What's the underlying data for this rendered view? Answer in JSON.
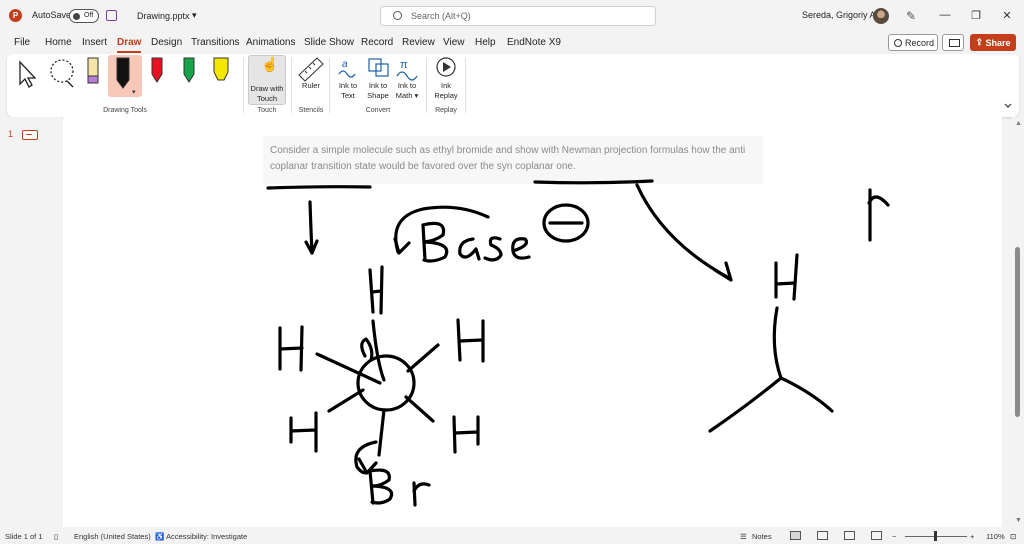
{
  "titlebar": {
    "autosave_label": "AutoSave",
    "autosave_state": "Off",
    "filename": "Drawing.pptx",
    "search_placeholder": "Search (Alt+Q)",
    "user_name": "Sereda, Grigoriy A"
  },
  "menu": {
    "tabs": [
      "File",
      "Home",
      "Insert",
      "Draw",
      "Design",
      "Transitions",
      "Animations",
      "Slide Show",
      "Record",
      "Review",
      "View",
      "Help",
      "EndNote X9"
    ],
    "active_tab": "Draw",
    "record_label": "Record",
    "share_label": "Share"
  },
  "ribbon": {
    "groups": {
      "drawing_tools": "Drawing Tools",
      "touch": "Touch",
      "stencils": "Stencils",
      "convert": "Convert",
      "replay": "Replay"
    },
    "buttons": {
      "draw_with_touch_1": "Draw with",
      "draw_with_touch_2": "Touch",
      "ruler": "Ruler",
      "ink_to_text_1": "Ink to",
      "ink_to_text_2": "Text",
      "ink_to_shape_1": "Ink to",
      "ink_to_shape_2": "Shape",
      "ink_to_math_1": "Ink to",
      "ink_to_math_2": "Math",
      "ink_replay_1": "Ink",
      "ink_replay_2": "Replay"
    },
    "pen_colors": [
      "#111111",
      "#e81123",
      "#16a34a",
      "#f5e800"
    ]
  },
  "slides_panel": {
    "slide_number": "1"
  },
  "slide": {
    "question": "Consider a simple molecule such as ethyl bromide and show with Newman projection formulas how the anti coplanar transition state would be favored over the syn coplanar one."
  },
  "status": {
    "slide_info": "Slide 1 of 1",
    "language": "English (United States)",
    "accessibility": "Accessibility: Investigate",
    "notes": "Notes",
    "zoom": "110%"
  },
  "colors": {
    "accent": "#c43e1c"
  }
}
